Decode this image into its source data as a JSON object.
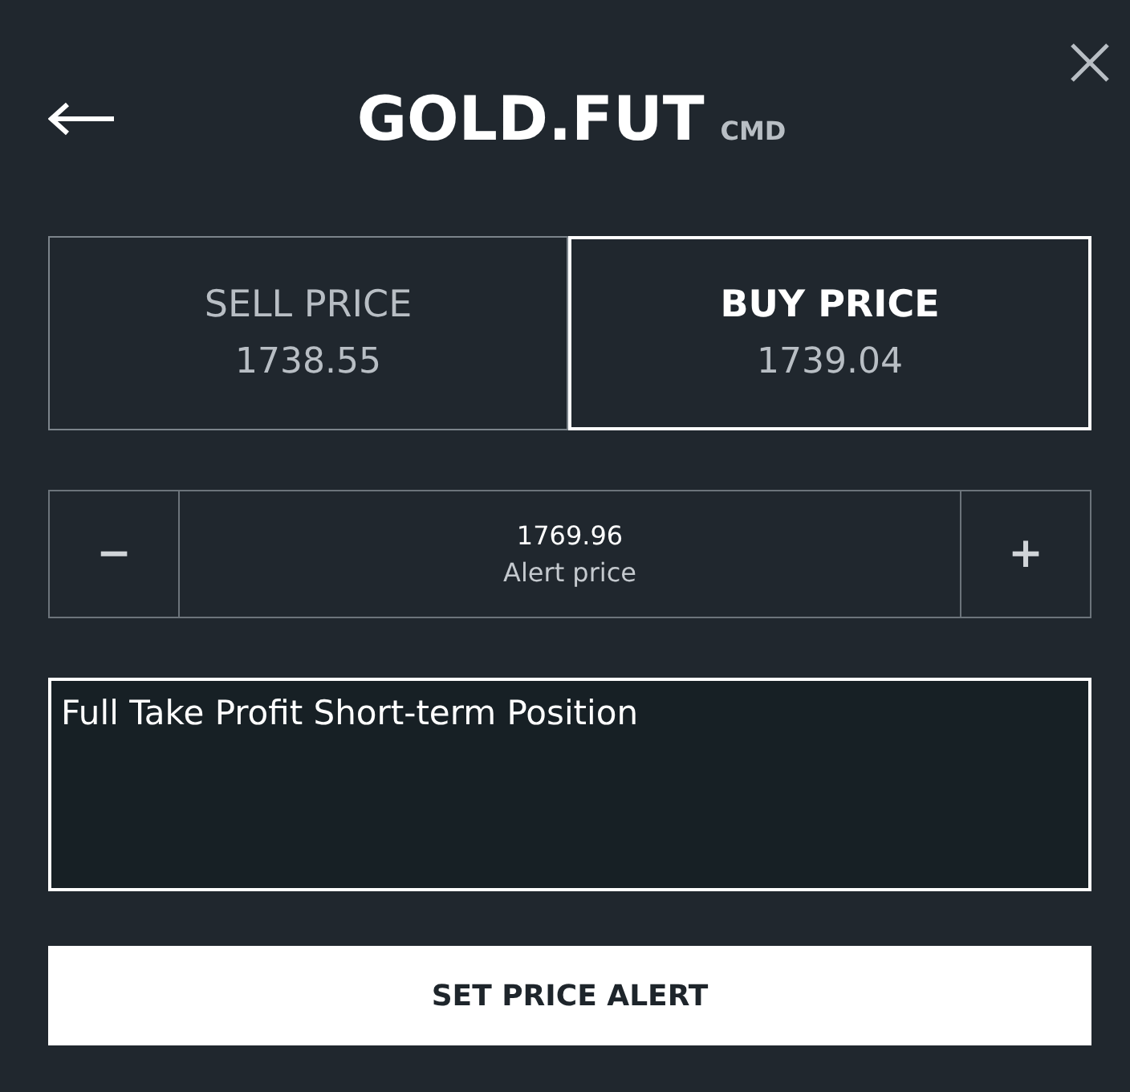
{
  "header": {
    "title": "GOLD.FUT",
    "tag": "CMD"
  },
  "price_tabs": [
    {
      "label": "SELL PRICE",
      "value": "1738.55",
      "selected": false
    },
    {
      "label": "BUY PRICE",
      "value": "1739.04",
      "selected": true
    }
  ],
  "stepper": {
    "decrement": "−",
    "value": "1769.96",
    "label": "Alert price",
    "increment": "+"
  },
  "note": {
    "value": "Full Take Profit Short-term Position"
  },
  "submit": {
    "label": "SET PRICE ALERT"
  }
}
